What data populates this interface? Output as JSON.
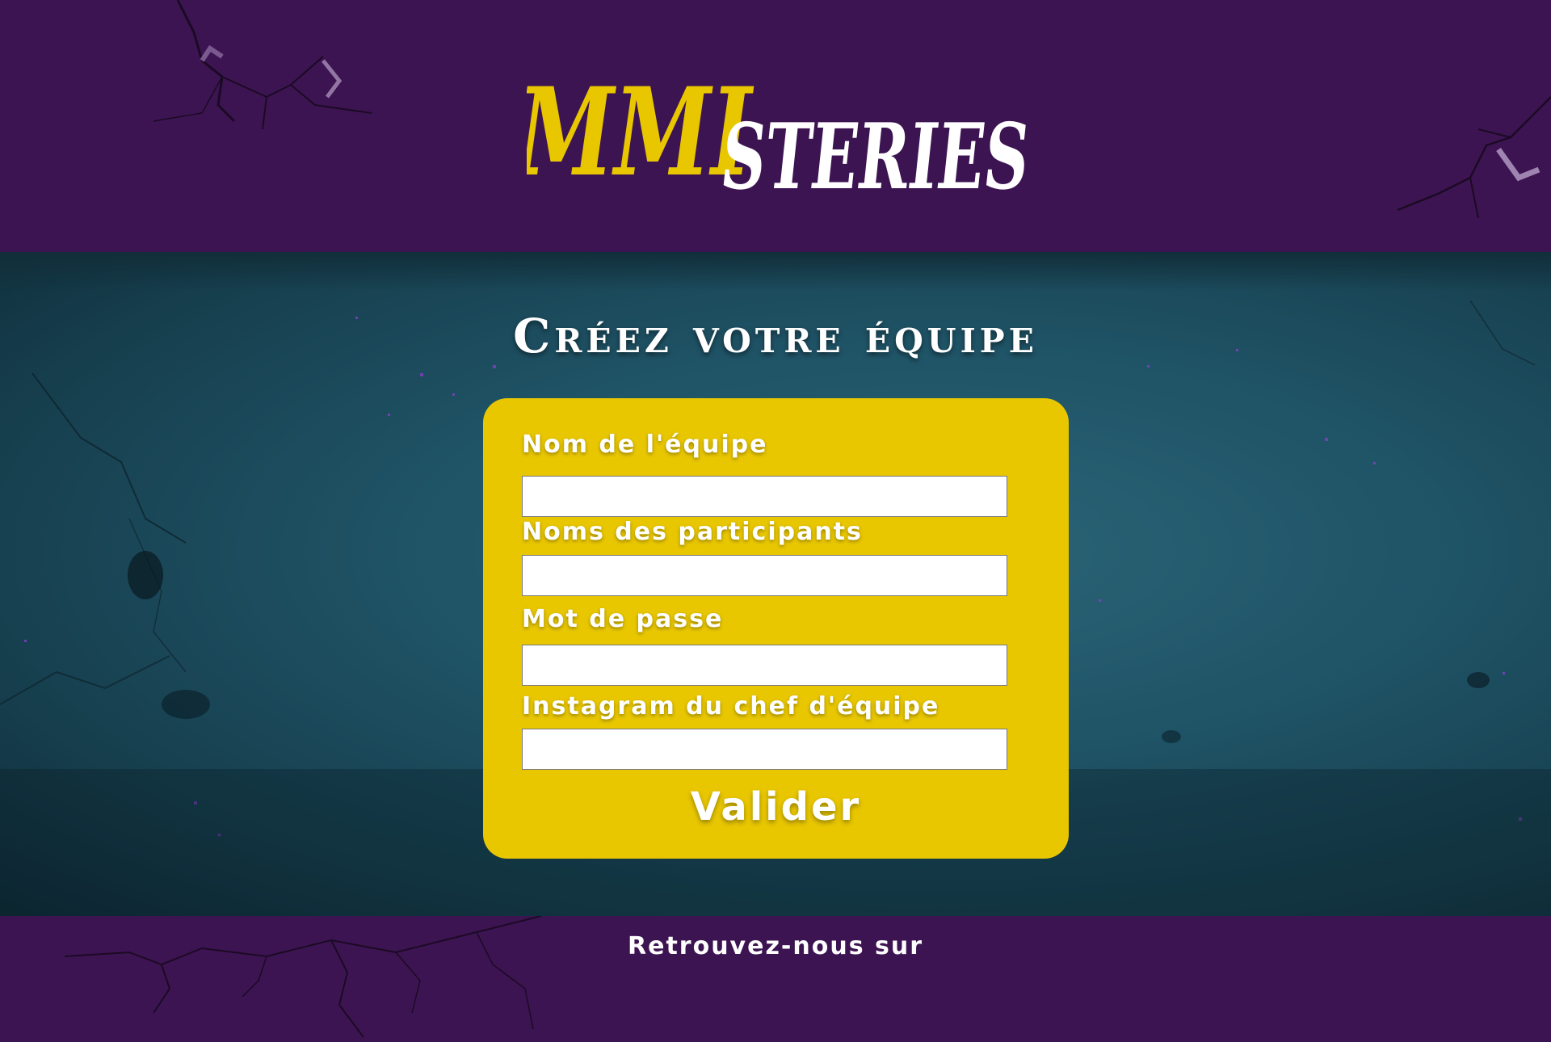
{
  "brand": {
    "logo_part1": "MMI",
    "logo_part2": "STERIES",
    "accent_color": "#e8c600",
    "header_color": "#3d1452"
  },
  "main": {
    "title": "Créez votre équipe"
  },
  "form": {
    "fields": [
      {
        "label": "Nom de l'équipe",
        "value": ""
      },
      {
        "label": "Noms des participants",
        "value": ""
      },
      {
        "label": "Mot de passe",
        "value": ""
      },
      {
        "label": "Instagram du chef d'équipe",
        "value": ""
      }
    ],
    "submit_label": "Valider"
  },
  "footer": {
    "text": "Retrouvez-nous sur"
  }
}
